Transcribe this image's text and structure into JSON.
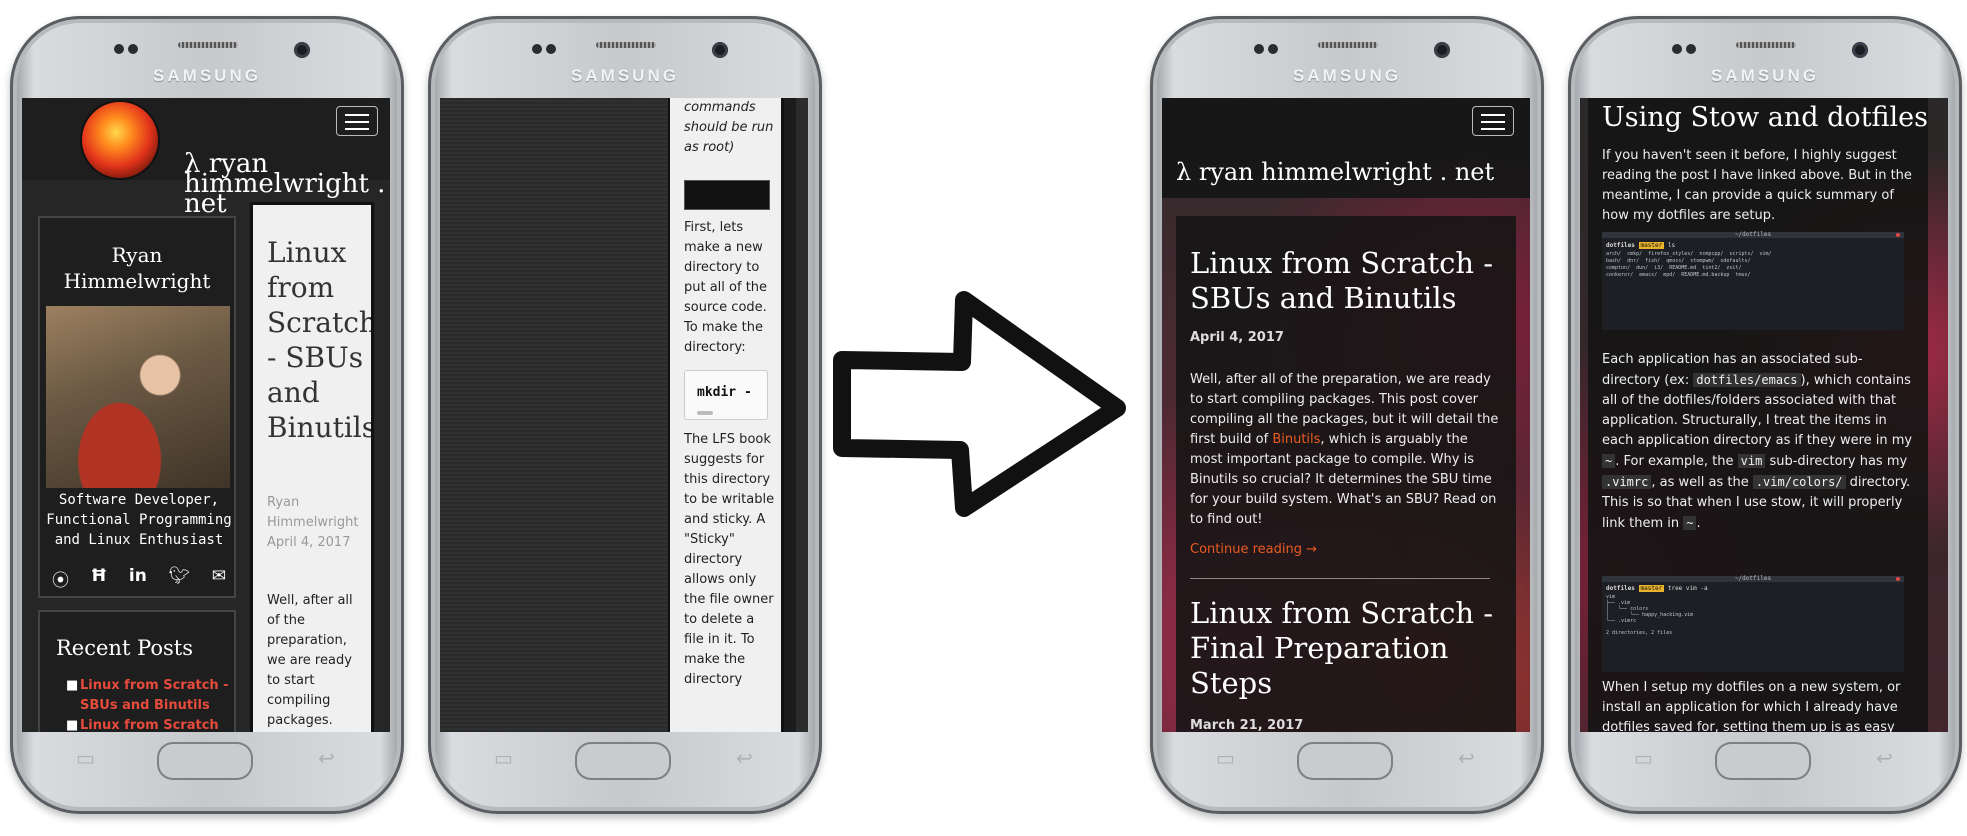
{
  "brand_text": "SAMSUNG",
  "colors": {
    "link_orange": "#ea5a22",
    "link_red": "#e64b3c",
    "card_bg": "#1e1e1e",
    "page_bg": "#2b2b2b"
  },
  "phone1": {
    "site_title": "λ ryan himmelwright . net",
    "profile_name": "Ryan Himmelwright",
    "profile_bio": "Software Developer, Functional Programming and Linux Enthusiast",
    "social_icons": [
      "github-icon",
      "hackaday-icon",
      "linkedin-icon",
      "twitter-icon",
      "email-icon"
    ],
    "recent_posts_heading": "Recent Posts",
    "recent_posts": [
      "Linux from Scratch - SBUs and Binutils",
      "Linux from Scratch"
    ],
    "post_title": "Linux from Scratch - SBUs and Binutils",
    "post_author": "Ryan Himmelwright",
    "post_date": "April 4, 2017",
    "post_excerpt": "Well, after all of the preparation, we are ready to start compiling packages."
  },
  "phone2": {
    "text_top": "commands should be run as root)",
    "para1": "First, lets make a new directory to put all of the source code. To make the directory:",
    "code_block": "mkdir -",
    "para2": "The LFS book suggests for this directory to be writable and sticky. A \"Sticky\" directory allows only the file owner to delete a file in it. To make the directory"
  },
  "arrow_icon": "right-arrow-icon",
  "phone3": {
    "site_title": "λ ryan himmelwright . net",
    "post1_title": "Linux from Scratch - SBUs and Binutils",
    "post1_date": "April 4, 2017",
    "post1_excerpt_before": "Well, after all of the preparation, we are ready to start compiling packages. This post cover compiling all the packages, but it will detail the first build of ",
    "post1_link": "Binutils",
    "post1_excerpt_after": ", which is arguably the most important package to compile. Why is Binutils so crucial? It determines the SBU time for your build system. What's an SBU? Read on to find out!",
    "continue_reading": "Continue reading →",
    "post2_title": "Linux from Scratch - Final Preparation Steps",
    "post2_date": "March 21, 2017"
  },
  "phone4": {
    "heading": "Using Stow and dotfiles",
    "para1": "If you haven't seen it before, I highly suggest reading the post I have linked above. But in the meantime, I can provide a quick summary of how my dotfiles are setup.",
    "term1": {
      "title": "~/dotfiles",
      "prompt": "dotfiles",
      "branch": "master",
      "cmd": "ls",
      "listing": [
        "arch/  cmkp/  firefox_styles/  ncmpcpp/  scripts/  vim/",
        "bash/  dnr/  fish/  qmocs/  stompwm/  xdefaults/",
        "compton/  dun/  i3/  README.md  tint2/  zsit/",
        "conkeror/  emacs/  mpd/  README.md.backup  tmux/"
      ]
    },
    "p2_a": "Each application has an associated sub-directory (ex: ",
    "p2_code1": "dotfiles/emacs",
    "p2_b": "), which contains all of the dotfiles/folders associated with that application. Structurally, I treat the items in each application directory as if they were in my ",
    "p2_code2": "~",
    "p2_c": ". For example, the ",
    "p2_code3": "vim",
    "p2_d": " sub-directory has my ",
    "p2_code4": ".vimrc",
    "p2_e": ", as well as the ",
    "p2_code5": ".vim/colors/",
    "p2_f": " directory. This is so that when I use stow, it will properly link them in ",
    "p2_code6": "~",
    "p2_g": ".",
    "term2": {
      "title": "~/dotfiles",
      "prompt": "dotfiles",
      "branch": "master",
      "cmd": "tree vim -a",
      "listing": [
        "vim",
        "├── .vim",
        "│   └── colors",
        "│       └── happy_hacking.vim",
        "└── .vimrc",
        "",
        "2 directories, 2 files"
      ]
    },
    "para3": "When I setup my dotfiles on a new system, or install an application for which I already have dotfiles saved for, setting them up is as easy"
  }
}
